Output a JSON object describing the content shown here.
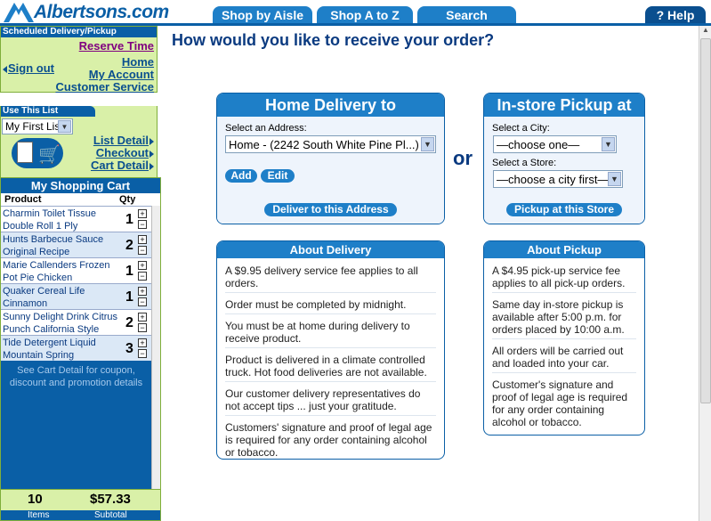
{
  "header": {
    "logo_text": "Albertsons.com",
    "tabs": [
      "Shop by Aisle",
      "Shop A to Z",
      "Search"
    ],
    "help_label": "? Help"
  },
  "sidebar": {
    "scheduled": {
      "heading": "Scheduled Delivery/Pickup",
      "reserve_time": "Reserve Time",
      "sign_out": "Sign out",
      "home": "Home",
      "my_account": "My Account",
      "customer_service": "Customer Service"
    },
    "use_list": {
      "heading": "Use This List",
      "selected_list": "My First List",
      "list_detail": "List Detail",
      "checkout": "Checkout",
      "cart_detail": "Cart Detail"
    },
    "cart": {
      "title": "My Shopping Cart",
      "col_product": "Product",
      "col_qty": "Qty",
      "items": [
        {
          "name": "Charmin Toilet Tissue Double Roll 1 Ply",
          "qty": "1"
        },
        {
          "name": "Hunts Barbecue Sauce Original Recipe",
          "qty": "2"
        },
        {
          "name": "Marie Callenders Frozen Pot Pie Chicken",
          "qty": "1"
        },
        {
          "name": "Quaker Cereal Life Cinnamon",
          "qty": "1"
        },
        {
          "name": "Sunny Delight Drink Citrus Punch California Style",
          "qty": "2"
        },
        {
          "name": "Tide Detergent Liquid Mountain Spring",
          "qty": "3"
        }
      ],
      "note": "See Cart Detail for coupon, discount and promotion details",
      "items_count": "10",
      "items_label": "Items",
      "subtotal": "$57.33",
      "subtotal_label": "Subtotal"
    }
  },
  "main": {
    "title": "How would you like to receive your order?",
    "home_delivery": {
      "title": "Home Delivery to",
      "address_label": "Select an Address:",
      "address_value": "Home - (2242 South White Pine Pl...)",
      "add_label": "Add",
      "edit_label": "Edit",
      "deliver_button": "Deliver to this Address"
    },
    "or_text": "or",
    "pickup": {
      "title": "In-store Pickup at",
      "city_label": "Select a City:",
      "city_value": "—choose one—",
      "store_label": "Select a Store:",
      "store_value": "—choose a city first—",
      "pickup_button": "Pickup at this Store"
    },
    "about_delivery": {
      "title": "About Delivery",
      "items": [
        "A $9.95 delivery service fee applies to all orders.",
        "Order must be completed by midnight.",
        "You must be at home during delivery to receive product.",
        "Product is delivered in a climate controlled truck. Hot food deliveries are not available.",
        "Our customer delivery representatives do not accept tips ... just your gratitude.",
        "Customers' signature and proof of legal age is required for any order containing alcohol or tobacco."
      ]
    },
    "about_pickup": {
      "title": "About Pickup",
      "items": [
        "A $4.95 pick-up service fee applies to all pick-up orders.",
        "Same day in-store pickup is available after 5:00 p.m. for orders placed by 10:00 a.m.",
        "All orders will be carried out and loaded into your car.",
        "Customer's signature and proof of legal age is required for any order containing alcohol or tobacco."
      ]
    }
  },
  "colors": {
    "brand_blue": "#0a5fa6",
    "tab_blue": "#1e7fc8",
    "sidebar_green": "#d9f0a8",
    "title_navy": "#0a3a80"
  }
}
